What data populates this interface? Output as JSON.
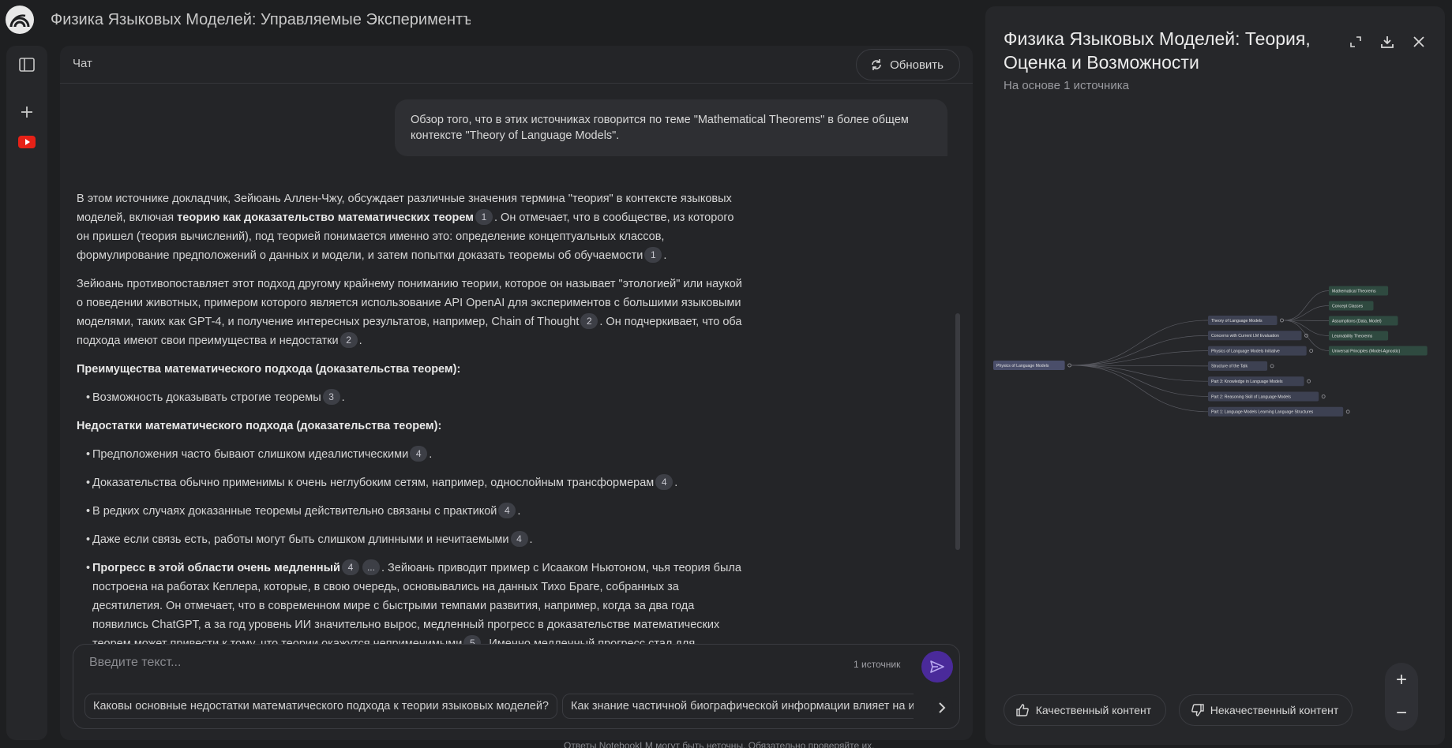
{
  "app": {
    "title": "Физика Языковых Моделей: Управляемые Экспериментъ"
  },
  "rail": {
    "toggle_icon": "sidebar-icon",
    "add_icon": "plus-icon",
    "source_icon": "youtube-icon",
    "accent": "#e62117"
  },
  "chat": {
    "title": "Чат",
    "refresh_label": "Обновить",
    "user_message": "Обзор того, что в этих источниках говорится по теме \"Mathematical Theorems\" в более общем контексте \"Theory of Language Models\".",
    "p1": {
      "a": "В этом источнике докладчик, Зейюань Аллен-Чжу, обсуждает различные значения термина \"теория\" в контексте языковых моделей, включая ",
      "b": "теорию как доказательство математических теорем",
      "c1": "1",
      "d": ". Он отмечает, что в сообществе, из которого он пришел (теория вычислений), под теорией понимается именно это: определение концептуальных классов, формулирование предположений о данных и модели, и затем попытки доказать теоремы об обучаемости",
      "c2": "1",
      "e": "."
    },
    "p2": {
      "a": "Зейюань противопоставляет этот подход другому крайнему пониманию теории, которое он называет \"этологией\" или наукой о поведении животных, примером которого является использование API OpenAI для экспериментов с большими языковыми моделями, таких как GPT-4, и получение интересных результатов, например, Chain of Thought",
      "c1": "2",
      "b": ". Он подчеркивает, что оба подхода имеют свои преимущества и недостатки",
      "c2": "2",
      "e": "."
    },
    "adv_heading": "Преимущества математического подхода (доказательства теорем):",
    "adv_item": {
      "text": "Возможность доказывать строгие теоремы",
      "cite": "3"
    },
    "dis_heading": "Недостатки математического подхода (доказательства теорем):",
    "dis_items": [
      {
        "text": "Предположения часто бывают слишком идеалистическими",
        "cite": "4"
      },
      {
        "text": "Доказательства обычно применимы к очень неглубоким сетям, например, однослойным трансформерам",
        "cite": "4"
      },
      {
        "text": "В редких случаях доказанные теоремы действительно связаны с практикой",
        "cite": "4"
      },
      {
        "text": "Даже если связь есть, работы могут быть слишком длинными и нечитаемыми",
        "cite": "4"
      }
    ],
    "last_item": {
      "bold": "Прогресс в этой области очень медленный",
      "cite": "4",
      "more": "...",
      "text": ". Зейюань приводит пример с Исааком Ньютоном, чья теория была построена на работах Кеплера, которые, в свою очередь, основывались на данных Тихо Браге, собранных за десятилетия. Он отмечает, что в современном мире с быстрыми темпами развития, например, когда за два года появились ChatGPT, а за год уровень ИИ значительно вырос, медленный прогресс в доказательстве математических теорем может привести к тому, что теории окажутся неприменимыми",
      "cite2": "5",
      "tail": ". Именно медленный прогресс стал для докладчика основной причиной ухода из этого"
    }
  },
  "composer": {
    "placeholder": "Введите текст...",
    "source_count": "1 источник",
    "send_icon": "send-icon",
    "send_color": "#4a2a9a",
    "suggestions": [
      "Каковы основные недостатки математического подхода к теории языковых моделей?",
      "Как знание частичной биографической информации влияет на извлечение знаний?"
    ]
  },
  "disclaimer": "Ответы NotebookLM могут быть неточны. Обязательно проверяйте их.",
  "panel": {
    "title": "Физика Языковых Моделей: Теория, Оценка и Возможности",
    "subtitle": "На основе 1 источника",
    "icons": [
      "expand-icon",
      "download-icon",
      "close-icon"
    ],
    "mindmap": {
      "root": "Physics of Language Models",
      "branches": [
        "Theory of Language Models",
        "Concerns with Current LM Evaluation",
        "Physics of Language Models Initiative",
        "Structure of the Talk",
        "Part 3: Knowledge in Language Models",
        "Part 2: Reasoning Skill of Language Models",
        "Part 1: Language Models Learning Language Structures"
      ],
      "leaves": [
        "Mathematical Theorems",
        "Concept Classes",
        "Assumptions (Data, Model)",
        "Learnability Theorems",
        "Universal Principles (Model-Agnostic)"
      ],
      "root_color": "#4a4e6a",
      "branch_color": "#3d4152",
      "leaf_color": "#2f4a40"
    },
    "zoom_in": "+",
    "zoom_out": "−",
    "good_label": "Качественный контент",
    "bad_label": "Некачественный контент"
  }
}
